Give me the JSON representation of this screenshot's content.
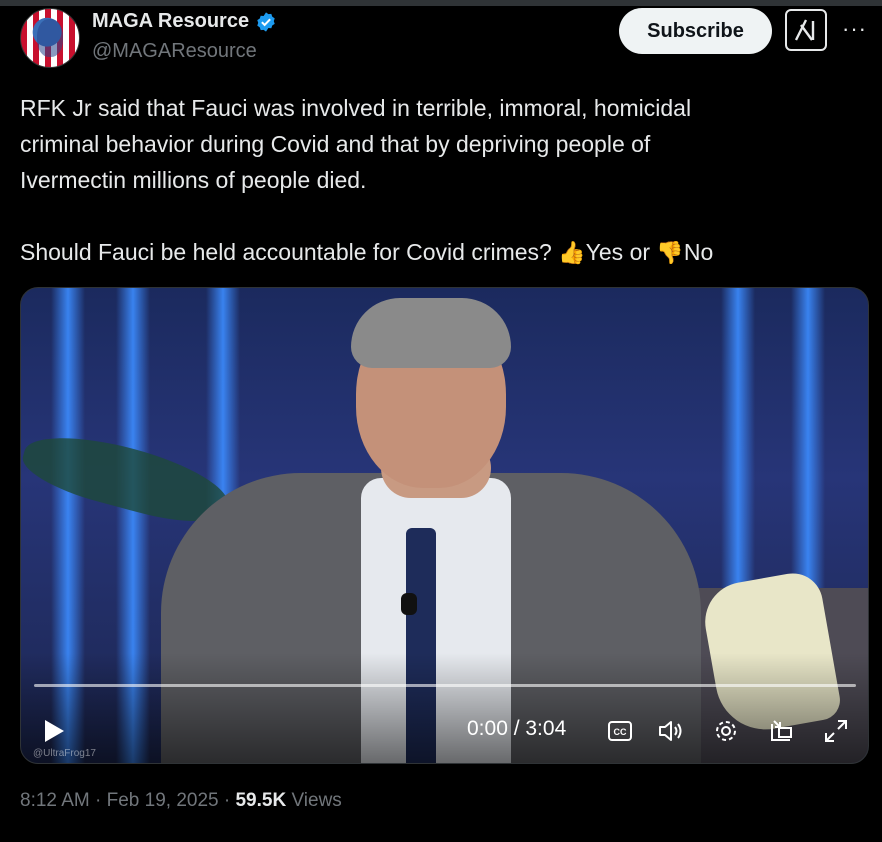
{
  "tweet": {
    "display_name": "MAGA Resource",
    "handle": "@MAGAResource",
    "subscribe_label": "Subscribe",
    "more_label": "···",
    "text_line1": "RFK Jr said that Fauci was involved in terrible, immoral, homicidal",
    "text_line2": "criminal behavior during Covid and that by depriving people of",
    "text_line3": "Ivermectin millions of people died.",
    "question": "Should Fauci be held accountable for Covid crimes?",
    "yes_label": "Yes or",
    "no_label": "No"
  },
  "video": {
    "time": "0:00 / 3:04",
    "watermark": "@UltraFrog17",
    "progress": 0
  },
  "meta": {
    "time": "8:12 AM",
    "sep1": " · ",
    "date": "Feb 19, 2025",
    "sep2": " · ",
    "views_count": "59.5K",
    "views_label": " Views"
  },
  "icons": {
    "verified": "verified-badge-icon",
    "grok": "grok-icon",
    "thumbs_up": "thumbs-up-icon",
    "thumbs_down": "thumbs-down-icon",
    "play": "play-icon",
    "captions": "captions-icon",
    "volume": "volume-icon",
    "settings": "settings-icon",
    "pip": "picture-in-picture-icon",
    "fullscreen": "fullscreen-icon"
  },
  "colors": {
    "background": "#000000",
    "verified": "#1d9bf0",
    "secondary_text": "#71767b",
    "primary_text": "#e7e9ea"
  }
}
